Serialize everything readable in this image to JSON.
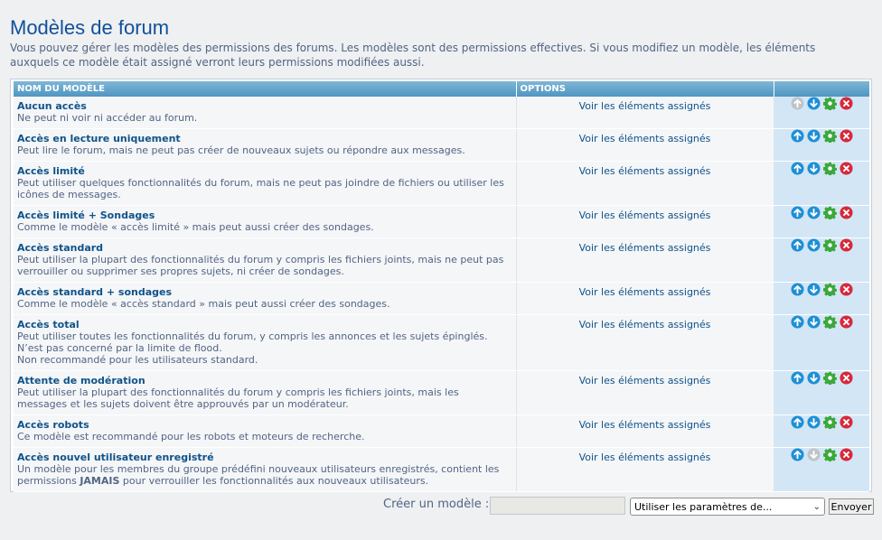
{
  "page": {
    "title": "Modèles de forum",
    "intro": "Vous pouvez gérer les modèles des permissions des forums. Les modèles sont des permissions effectives. Si vous modifiez un modèle, les éléments auxquels ce modèle était assigné verront leurs permissions modifiées aussi."
  },
  "table": {
    "col_name": "NOM DU MODÈLE",
    "col_options": "OPTIONS",
    "rows": [
      {
        "name": "Aucun accès",
        "lines": [
          "Ne peut ni voir ni accéder au forum."
        ],
        "link": "Voir les éléments assignés",
        "up_disabled": true,
        "down_disabled": false
      },
      {
        "name": "Accès en lecture uniquement",
        "lines": [
          "Peut lire le forum, mais ne peut pas créer de nouveaux sujets ou répondre aux messages."
        ],
        "link": "Voir les éléments assignés",
        "up_disabled": false,
        "down_disabled": false
      },
      {
        "name": "Accès limité",
        "lines": [
          "Peut utiliser quelques fonctionnalités du forum, mais ne peut pas joindre de fichiers ou utiliser les icônes de messages."
        ],
        "link": "Voir les éléments assignés",
        "up_disabled": false,
        "down_disabled": false
      },
      {
        "name": "Accès limité + Sondages",
        "lines": [
          "Comme le modèle « accès limité » mais peut aussi créer des sondages."
        ],
        "link": "Voir les éléments assignés",
        "up_disabled": false,
        "down_disabled": false
      },
      {
        "name": "Accès standard",
        "lines": [
          "Peut utiliser la plupart des fonctionnalités du forum y compris les fichiers joints, mais ne peut pas verrouiller ou supprimer ses propres sujets, ni créer de sondages."
        ],
        "link": "Voir les éléments assignés",
        "up_disabled": false,
        "down_disabled": false
      },
      {
        "name": "Accès standard + sondages",
        "lines": [
          "Comme le modèle « accès standard » mais peut aussi créer des sondages."
        ],
        "link": "Voir les éléments assignés",
        "up_disabled": false,
        "down_disabled": false
      },
      {
        "name": "Accès total",
        "lines": [
          "Peut utiliser toutes les fonctionnalités du forum, y compris les annonces et les sujets épinglés. N’est pas concerné par la limite de flood.",
          "Non recommandé pour les utilisateurs standard."
        ],
        "link": "Voir les éléments assignés",
        "up_disabled": false,
        "down_disabled": false
      },
      {
        "name": "Attente de modération",
        "lines": [
          "Peut utiliser la plupart des fonctionnalités du forum y compris les fichiers joints, mais les messages et les sujets doivent être approuvés par un modérateur."
        ],
        "link": "Voir les éléments assignés",
        "up_disabled": false,
        "down_disabled": false
      },
      {
        "name": "Accès robots",
        "lines": [
          "Ce modèle est recommandé pour les robots et moteurs de recherche."
        ],
        "link": "Voir les éléments assignés",
        "up_disabled": false,
        "down_disabled": false
      },
      {
        "name": "Accès nouvel utilisateur enregistré",
        "desc_pre": "Un modèle pour les membres du groupe prédéfini nouveaux utilisateurs enregistrés, contient les permissions ",
        "desc_em": "JAMAIS",
        "desc_post": " pour verrouiller les fonctionnalités aux nouveaux utilisateurs.",
        "link": "Voir les éléments assignés",
        "up_disabled": false,
        "down_disabled": true
      }
    ]
  },
  "icons": {
    "move_up": "arrow-up-circle-icon",
    "move_down": "arrow-down-circle-icon",
    "edit": "gear-icon",
    "delete": "delete-x-icon"
  },
  "colors": {
    "title": "#115098",
    "header_gradient_top": "#7fb6d6",
    "header_gradient_bottom": "#4f95c2",
    "action_cell_bg": "#d3e6f6",
    "arrow_blue": "#1e8fd6",
    "gear_green": "#3ba83b",
    "delete_red": "#d8293a",
    "disabled_gray": "#bfc4c8"
  },
  "footer": {
    "create_label": "Créer un modèle :",
    "name_value": "",
    "select_value": "Utiliser les paramètres de...",
    "submit_label": "Envoyer"
  }
}
